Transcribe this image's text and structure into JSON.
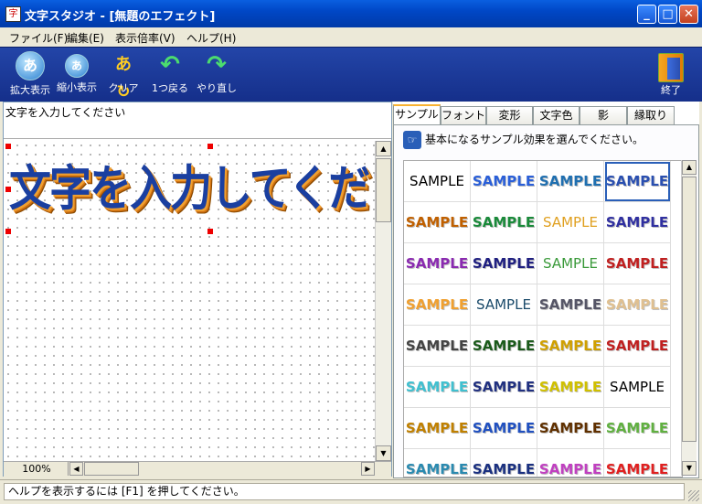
{
  "window": {
    "title": "文字スタジオ - [無題のエフェクト]",
    "icon": "app-icon",
    "buttons": {
      "minimize": "_",
      "maximize": "□",
      "close": "✕"
    }
  },
  "menu": [
    "ファイル(F)",
    "編集(E)",
    "表示倍率(V)",
    "ヘルプ(H)"
  ],
  "toolbar": {
    "items": [
      {
        "label": "拡大表示",
        "glyph": "あ",
        "icon": "zoom-in-icon"
      },
      {
        "label": "縮小表示",
        "glyph": "あ",
        "icon": "zoom-out-icon"
      },
      {
        "label": "クリア",
        "glyph": "あ↻",
        "icon": "clear-icon"
      },
      {
        "label": "1つ戻る",
        "glyph": "↶",
        "icon": "undo-icon"
      },
      {
        "label": "やり直し",
        "glyph": "↷",
        "icon": "redo-icon"
      }
    ],
    "exit_label": "終了"
  },
  "editor": {
    "input_text": "文字を入力してください",
    "canvas_text": "文字を入力してくださ",
    "zoom": "100%"
  },
  "tabs": [
    "サンプル",
    "フォント",
    "変形",
    "文字色",
    "影",
    "縁取り"
  ],
  "active_tab": 0,
  "samples_hint": "基本になるサンプル効果を選んでください。",
  "sample_label": "SAMPLE",
  "sample_styles": [
    {
      "c": "#000",
      "bg": "#fff",
      "w": "normal"
    },
    {
      "c": "#2a5fd8",
      "bg": "#fff",
      "w": "bold"
    },
    {
      "c": "#1f6fb0",
      "bg": "#fff",
      "w": "bold"
    },
    {
      "c": "#2a4fb0",
      "bg": "#fff",
      "w": "bold"
    },
    {
      "c": "#c06000",
      "bg": "#fff",
      "w": "bold"
    },
    {
      "c": "#1a8a3a",
      "bg": "#fff",
      "w": "bold"
    },
    {
      "c": "#e0a020",
      "bg": "#fff",
      "w": "normal"
    },
    {
      "c": "#3030a0",
      "bg": "#fff",
      "w": "bold"
    },
    {
      "c": "#8a2ab0",
      "bg": "#fff",
      "w": "bold"
    },
    {
      "c": "#202080",
      "bg": "#fff",
      "w": "bold"
    },
    {
      "c": "#3a9a3a",
      "bg": "#fff",
      "w": "normal"
    },
    {
      "c": "#c02020",
      "bg": "#fff",
      "w": "bold"
    },
    {
      "c": "#f0a030",
      "bg": "#fff",
      "w": "bold"
    },
    {
      "c": "#1a4a6a",
      "bg": "#fff",
      "w": "normal"
    },
    {
      "c": "#556",
      "bg": "#fff",
      "w": "bold"
    },
    {
      "c": "#e0c090",
      "bg": "#fff",
      "w": "bold"
    },
    {
      "c": "#444",
      "bg": "#fff",
      "w": "bold"
    },
    {
      "c": "#1a5a1a",
      "bg": "#fff",
      "w": "bold"
    },
    {
      "c": "#d0a000",
      "bg": "#fff",
      "w": "bold"
    },
    {
      "c": "#c02020",
      "bg": "#fff",
      "w": "bold"
    },
    {
      "c": "#40c0d0",
      "bg": "#fff",
      "w": "bold"
    },
    {
      "c": "#203080",
      "bg": "#fff",
      "w": "bold"
    },
    {
      "c": "#d0c000",
      "bg": "#fff",
      "w": "bold"
    },
    {
      "c": "#000",
      "bg": "#fff",
      "w": "normal"
    },
    {
      "c": "#c08000",
      "bg": "#fff",
      "w": "bold"
    },
    {
      "c": "#2050c0",
      "bg": "#fff",
      "w": "bold"
    },
    {
      "c": "#603000",
      "bg": "#fff",
      "w": "bold"
    },
    {
      "c": "#60b040",
      "bg": "#fff",
      "w": "bold"
    },
    {
      "c": "#2a8ab0",
      "bg": "#fff",
      "w": "bold"
    },
    {
      "c": "#1a3080",
      "bg": "#fff",
      "w": "bold"
    },
    {
      "c": "#c040c0",
      "bg": "#fff",
      "w": "bold"
    },
    {
      "c": "#e02020",
      "bg": "#fff",
      "w": "bold"
    }
  ],
  "selected_sample": 3,
  "status_text": "ヘルプを表示するには [F1] を押してください。"
}
